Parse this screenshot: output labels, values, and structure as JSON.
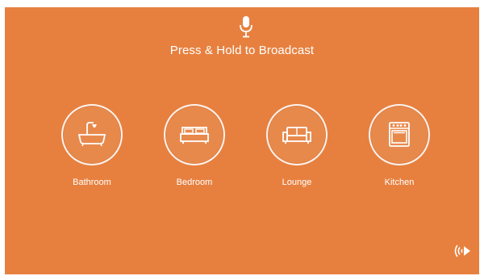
{
  "header": {
    "mic_icon": "microphone-icon",
    "title": "Press & Hold to Broadcast"
  },
  "rooms": [
    {
      "label": "Bathroom",
      "icon": "bathtub-icon"
    },
    {
      "label": "Bedroom",
      "icon": "bed-icon"
    },
    {
      "label": "Lounge",
      "icon": "sofa-icon"
    },
    {
      "label": "Kitchen",
      "icon": "oven-icon"
    }
  ],
  "footer": {
    "broadcast_icon": "broadcast-play-icon"
  },
  "colors": {
    "background": "#e7803f",
    "foreground": "#ffffff"
  }
}
